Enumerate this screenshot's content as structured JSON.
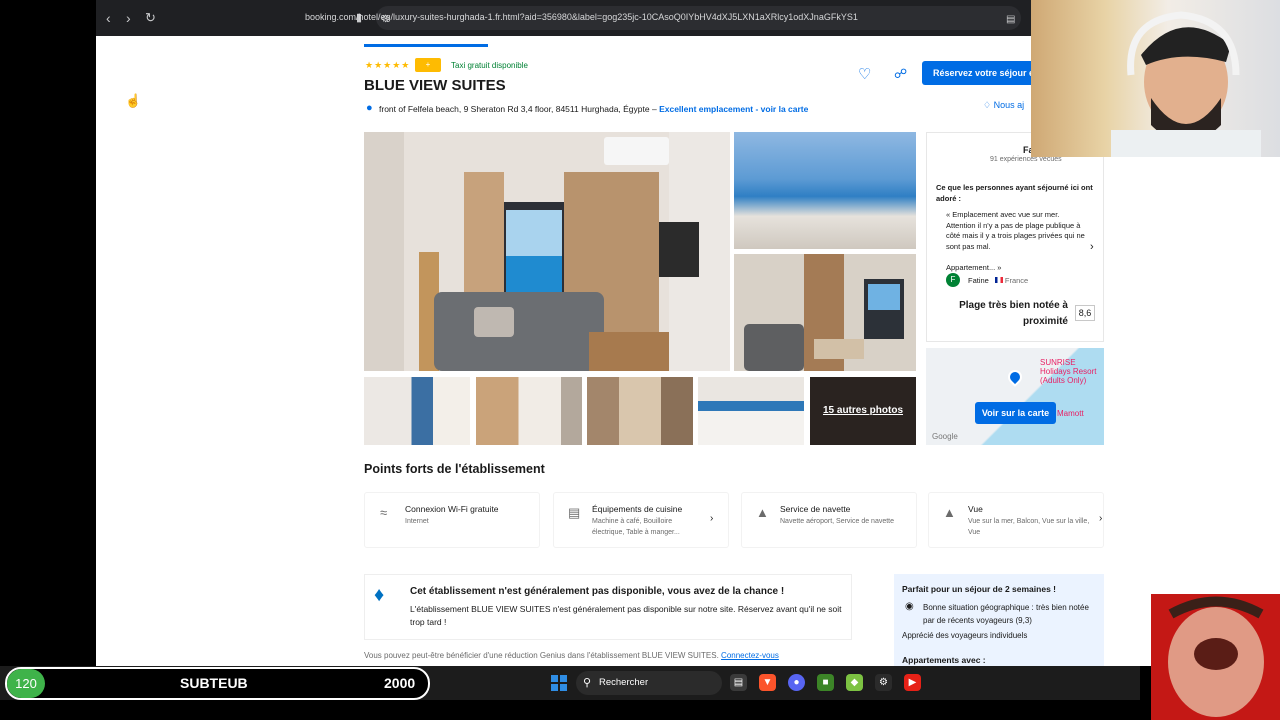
{
  "browser": {
    "url": "booking.com/hotel/eg/luxury-suites-hurghada-1.fr.html?aid=356980&label=gog235jc-10CAsoQ0IYbHV4dXJ5LXN1aXRlcy1odXJnaGFkYS1",
    "icons": [
      "back-icon",
      "forward-icon",
      "reload-icon",
      "bookmark-icon",
      "site-info-icon",
      "reader-icon"
    ]
  },
  "hotel": {
    "badge": "+",
    "taxi": "Taxi gratuit disponible",
    "name": "BLUE VIEW SUITES",
    "address": "front of Felfela beach, 9 Sheraton Rd 3,4 floor, 84511 Hurghada, Égypte –",
    "address_link": "Excellent emplacement - voir la carte",
    "reserve_button": "Réservez votre séjour ei",
    "price_match": "Nous aj"
  },
  "photos": {
    "more_label": "15 autres photos"
  },
  "reviews": {
    "score_label": "Fa",
    "count_text": "91 expériences vécues",
    "heading": "Ce que les personnes ayant séjourné ici ont adoré :",
    "quote": "« Emplacement avec vue sur mer. Attention il n'y a pas de plage publique à côté mais il y a trois plages privées qui ne sont pas mal.",
    "more_text": "Appartement... »",
    "reviewer": "Fatine",
    "reviewer_initial": "F",
    "reviewer_country": "France",
    "beach_label": "Plage très bien notée à proximité",
    "beach_score": "8,6"
  },
  "map": {
    "button": "Voir sur la carte",
    "label1": "SUNRISE Holidays Resort (Adults Only)",
    "label2": "Mamott",
    "google": "Google"
  },
  "highlights": {
    "title": "Points forts de l'établissement",
    "items": [
      {
        "title": "Connexion Wi-Fi gratuite",
        "sub": "Internet",
        "icon": "wifi-icon"
      },
      {
        "title": "Équipements de cuisine",
        "sub": "Machine à café, Bouilloire électrique, Table à manger...",
        "icon": "kitchen-icon"
      },
      {
        "title": "Service de navette",
        "sub": "Navette aéroport, Service de navette",
        "icon": "shuttle-icon"
      },
      {
        "title": "Vue",
        "sub": "Vue sur la mer, Balcon, Vue sur la ville, Vue",
        "icon": "view-icon"
      }
    ]
  },
  "genius": {
    "title": "Cet établissement n'est généralement pas disponible, vous avez de la chance !",
    "body": "L'établissement BLUE VIEW SUITES n'est généralement pas disponible sur notre site. Réservez avant qu'il ne soit trop tard !",
    "promo": "Vous pouvez peut-être bénéficier d'une réduction Genius dans l'établissement BLUE VIEW SUITES.",
    "promo_link": "Connectez-vous"
  },
  "sejour": {
    "title": "Parfait pour un séjour de 2 semaines !",
    "location": "Bonne situation géographique : très bien notée par de récents voyageurs (9,3)",
    "travellers": "Apprécié des voyageurs individuels",
    "appartments": "Appartements avec :"
  },
  "overlay": {
    "sub_count": "120",
    "sub_name": "SUBTEUB",
    "sub_goal": "2000"
  },
  "taskbar": {
    "search_placeholder": "Rechercher",
    "apps": [
      "file-explorer-icon",
      "brave-browser-icon",
      "discord-icon",
      "minecraft-icon",
      "green-app-icon",
      "settings-icon",
      "youtube-icon"
    ]
  },
  "colors": {
    "accent": "#006ce4",
    "star": "#febb02",
    "sub_badge": "#3fb34a"
  }
}
